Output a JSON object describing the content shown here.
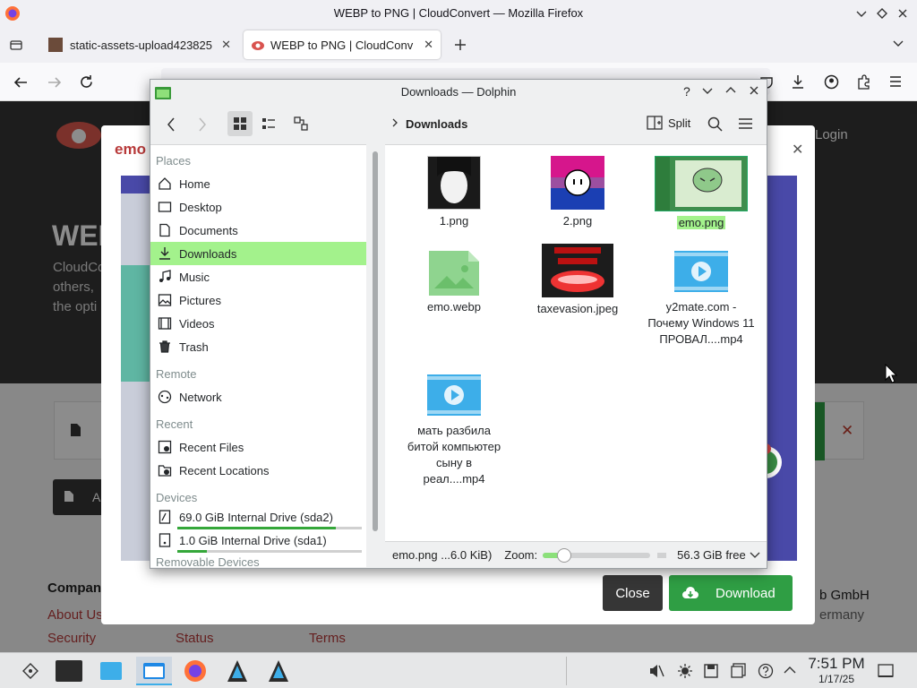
{
  "firefox": {
    "window_title": "WEBP to PNG | CloudConvert — Mozilla Firefox",
    "tabs": [
      {
        "label": "static-assets-upload42382‍5"
      },
      {
        "label": "WEBP to PNG | CloudConv"
      }
    ]
  },
  "page": {
    "login": "Login",
    "modal_file": "emo",
    "hero_title": "WEB",
    "hero_text": [
      "CloudCo",
      "others,",
      "the opti"
    ],
    "footer": {
      "company_heading": "Compan",
      "about": "About Us",
      "security": "Security",
      "status": "Status",
      "terms": "Terms",
      "gmbh": "b GmbH",
      "germany": "ermany"
    },
    "close_button": "Close",
    "download_button": "Download",
    "add_label": "A"
  },
  "dolphin": {
    "title": "Downloads — Dolphin",
    "breadcrumb": "Downloads",
    "split_label": "Split",
    "places": {
      "places_heading": "Places",
      "items": [
        "Home",
        "Desktop",
        "Documents",
        "Downloads",
        "Music",
        "Pictures",
        "Videos",
        "Trash"
      ],
      "remote_heading": "Remote",
      "network": "Network",
      "recent_heading": "Recent",
      "recent_files": "Recent Files",
      "recent_locations": "Recent Locations",
      "devices_heading": "Devices",
      "drive1": "69.0 GiB Internal Drive (sda2)",
      "drive2": "1.0 GiB Internal Drive (sda1)",
      "removable_heading": "Removable Devices"
    },
    "files": [
      {
        "name": "1.png"
      },
      {
        "name": "2.png"
      },
      {
        "name": "emo.png"
      },
      {
        "name": "emo.webp"
      },
      {
        "name": "taxevasion.jpeg"
      },
      {
        "name": "y2mate.com - Почему Windows 11 ПРОВАЛ....mp4"
      },
      {
        "name": "мать разбила битой компьютер сыну в реал....mp4"
      }
    ],
    "status": {
      "selection": "emo.png ...6.0 KiB)",
      "zoom_label": "Zoom:",
      "zoom_level": 0.2,
      "free_space": "56.3 GiB free"
    }
  },
  "taskbar": {
    "time": "7:51 PM",
    "date": "1/17/25"
  },
  "colors": {
    "selection_green": "#a3f28c",
    "download_green": "#2f9e44",
    "link_red": "#b83a3a",
    "video_blue": "#3daee9"
  }
}
